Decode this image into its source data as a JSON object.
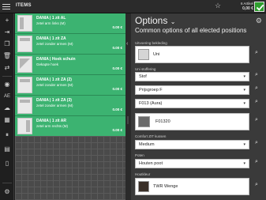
{
  "header": {
    "title": "ITEMS",
    "cart_count": "6 Artikel",
    "cart_total": "0,00 €"
  },
  "items": [
    {
      "name": "DANIA  |  1 zit AL",
      "desc": "zetel arm links (M)",
      "price": "0.00 €"
    },
    {
      "name": "DANIA  |  1 zit ZA",
      "desc": "zetel zonder armen (M)",
      "price": "0.00 €"
    },
    {
      "name": "DANIA  |  Hoek schuin",
      "desc": "Gekapte hoek",
      "price": "0.00 €"
    },
    {
      "name": "DANIA  |  1 zit ZA (2)",
      "desc": "zetel zonder armen (M)",
      "price": "0.00 €"
    },
    {
      "name": "DANIA  |  1 zit ZA (3)",
      "desc": "zetel zonder armen (M)",
      "price": "0.00 €"
    },
    {
      "name": "DANIA  |  1 zit AR",
      "desc": "zetel arm rechts (M)",
      "price": "0.00 €"
    }
  ],
  "options": {
    "title": "Options",
    "subtitle": "Common options of all elected positions",
    "sections": [
      {
        "label": "Uitvoering bekleding",
        "value": "Uni"
      },
      {
        "label": "Uni stoffering",
        "value": "Stof"
      },
      {
        "label": "",
        "value": "Prijsgroep F"
      },
      {
        "label": "",
        "value": "F013 (Aura)"
      },
      {
        "label": "",
        "value": "F01320"
      },
      {
        "label": "Comfort ZIT kussen",
        "value": "Medium"
      },
      {
        "label": "Poten",
        "value": "Houten poot"
      },
      {
        "label": "Houtkleur",
        "value": "TWR Wenge"
      }
    ]
  },
  "icons": {
    "menu": "hamburger-icon",
    "favorite": "star-icon",
    "confirm": "checkmark-icon",
    "settings": "gear-icon"
  },
  "colors": {
    "item_bg": "#3cb371",
    "confirm": "#2e9e2e",
    "panel_bg": "#3a3a3a"
  }
}
